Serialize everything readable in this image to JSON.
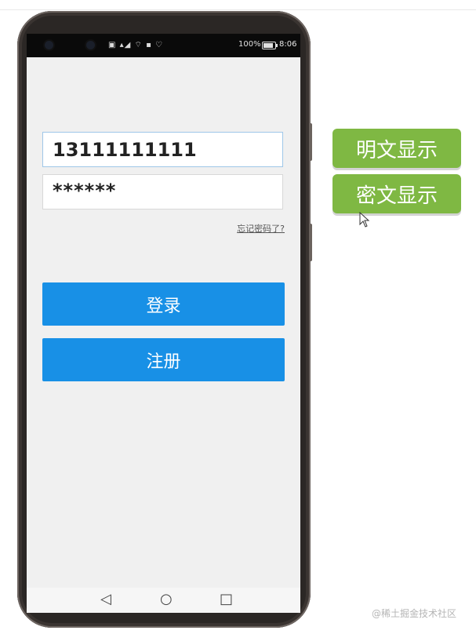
{
  "status_bar": {
    "battery_percent": "100%",
    "time": "8:06",
    "icons": [
      "notification-icon",
      "signal-icon",
      "wifi-icon",
      "nfc-icon",
      "heart-icon"
    ]
  },
  "login_form": {
    "phone_value": "13111111111",
    "password_value": "******",
    "forgot_password_label": "忘记密码了?",
    "login_button_label": "登录",
    "register_button_label": "注册"
  },
  "nav_bar": {
    "back": "◁",
    "home": "○",
    "recents": "□"
  },
  "side_actions": {
    "show_plain_label": "明文显示",
    "show_cipher_label": "密文显示"
  },
  "watermark": "@稀土掘金技术社区",
  "colors": {
    "primary_button": "#1890e6",
    "action_button": "#7fb843",
    "screen_background": "#f0f0f0"
  }
}
